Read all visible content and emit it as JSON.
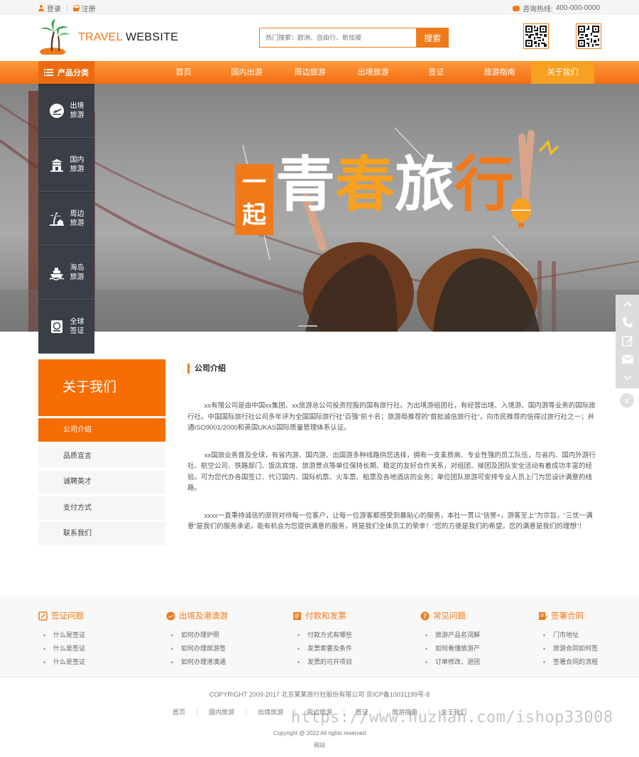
{
  "topbar": {
    "login": "登录",
    "register": "注册",
    "hotline_label": "咨询热线:",
    "hotline_number": "400-000-0000"
  },
  "header": {
    "logo_text_1": "TRAVEL",
    "logo_text_2": " WEBSITE",
    "search_placeholder": "热门搜索：欧洲、自由行、新加坡",
    "search_button": "搜索"
  },
  "nav": {
    "category_label": "产品分类",
    "items": [
      "首页",
      "国内出游",
      "周边旅游",
      "出境旅游",
      "签证",
      "旅游指南",
      "关于我们"
    ],
    "active": "关于我们"
  },
  "categories": [
    {
      "line1": "出境",
      "line2": "旅游",
      "icon": "plane-icon"
    },
    {
      "line1": "国内",
      "line2": "旅游",
      "icon": "temple-icon"
    },
    {
      "line1": "周边",
      "line2": "旅游",
      "icon": "palm-icon"
    },
    {
      "line1": "海岛",
      "line2": "旅游",
      "icon": "ship-icon"
    },
    {
      "line1": "全球",
      "line2": "签证",
      "icon": "visa-icon"
    }
  ],
  "banner": {
    "slogan_box": "一起",
    "slogan_1": "青",
    "slogan_2": "春",
    "slogan_3": "旅",
    "slogan_4": "行",
    "slide_count": 2,
    "active_slide": 2
  },
  "about": {
    "title": "关于我们",
    "menu": [
      "公司介绍",
      "品质宣言",
      "诚聘英才",
      "支付方式",
      "联系我们"
    ],
    "active": "公司介绍"
  },
  "content": {
    "heading": "公司介绍",
    "paragraphs": [
      "xx有限公司是由中国xx集团、xx旅游总公司投资控股的国有旅行社。为出境游组团社，有经营出境、入境游、国内游等业务的国际旅行社。中国国际旅行社公司多年评为全国国际旅行社“百强”前十名；旅游局推荐的“首批诚信旅行社”，向市民推荐的信得过旅行社之一；并通ISO9001/2000和英国UKAS国际质量管理体系认证。",
      "xx国旅业务普及全球，有省内游、国内游、出国游多种线路供您选择，拥有一支素质高、专业性强的员工队伍，与省内、国内外游行社、航空公司、铁路部门、饭店宾馆、旅游景点等单位保持长期、稳定的友好合作关系，对组团、接团及团队安全活动有着成功丰富的经验。可为您代办各国签订、代订国内、国际机票、火车票、船票及各地酒店的业务；单位团队旅游可安排专业人员上门为您设计满意的线路。",
      "xxxx一直秉持诚信的原则对待每一位客户，让每一位游客都感受到暴贴心的服务，本社一贯以“信誉+，游客至上”为宗旨，“三优一满意”是我们的服务承诺，能有机会为您提供满意的服务，将是我们全体员工的荣幸！“您的方便是我们的希望，您的满意是我们的理想”！"
    ]
  },
  "footer_links": [
    {
      "title": "签证问题",
      "icon": "visa-doc-icon",
      "items": [
        "什么是签证",
        "什么是签证",
        "什么是签证"
      ]
    },
    {
      "title": "出境及港澳游",
      "icon": "plane-icon",
      "items": [
        "如何办理护照",
        "如何办理旅游签",
        "如何办理港澳通"
      ]
    },
    {
      "title": "付款和发票",
      "icon": "invoice-icon",
      "items": [
        "付款方式有哪些",
        "发票索要及条件",
        "发票的可开项目"
      ]
    },
    {
      "title": "常见问题",
      "icon": "question-icon",
      "items": [
        "旅游产品名词解",
        "如何看懂旅游产",
        "订单修改、退团"
      ]
    },
    {
      "title": "签署合同",
      "icon": "contract-icon",
      "items": [
        "门市地址",
        "旅游合同如何签",
        "签署合同的流程"
      ]
    }
  ],
  "bottom": {
    "copyright": "COPYRIGHT 2009-2017 北京某某旅行社股份有限公司 京ICP备10031199号-8",
    "nav": [
      "首页",
      "国内旅游",
      "出境旅游",
      "周边旅游",
      "签证",
      "旅游指南",
      "关于我们"
    ],
    "copy2": "Copyright @ 2022   All rights reserved",
    "copy3": "网站",
    "watermark": "https://www.huzhan.com/ishop33008"
  },
  "colors": {
    "accent": "#f07a1a",
    "nav_gradient_top": "#fd9a3c",
    "nav_gradient_bottom": "#f36d12",
    "category_panel": "#3a3f47"
  }
}
